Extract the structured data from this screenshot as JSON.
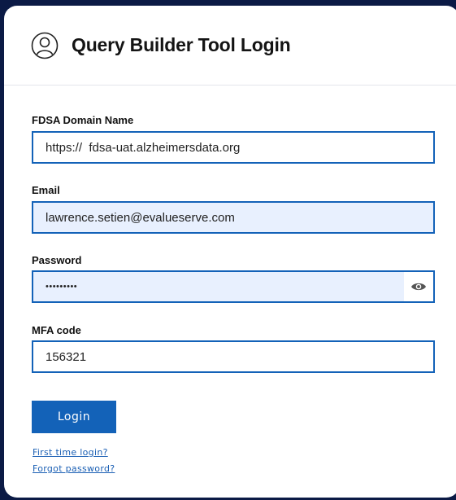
{
  "header": {
    "icon": "user-circle-icon",
    "title": "Query Builder Tool Login"
  },
  "form": {
    "domain": {
      "label": "FDSA Domain Name",
      "value": "https://  fdsa-uat.alzheimersdata.org"
    },
    "email": {
      "label": "Email",
      "value": "lawrence.setien@evalueserve.com"
    },
    "password": {
      "label": "Password",
      "value": "•••••••••",
      "toggle_icon": "eye-icon"
    },
    "mfa": {
      "label": "MFA code",
      "value": "156321"
    },
    "login_label": "Login"
  },
  "links": {
    "first_time": "First time login?",
    "forgot": "Forgot password?"
  },
  "colors": {
    "background": "#0b1a45",
    "accent": "#1362b8",
    "autofill": "#e8f0fe",
    "link": "#1a5fb4"
  }
}
